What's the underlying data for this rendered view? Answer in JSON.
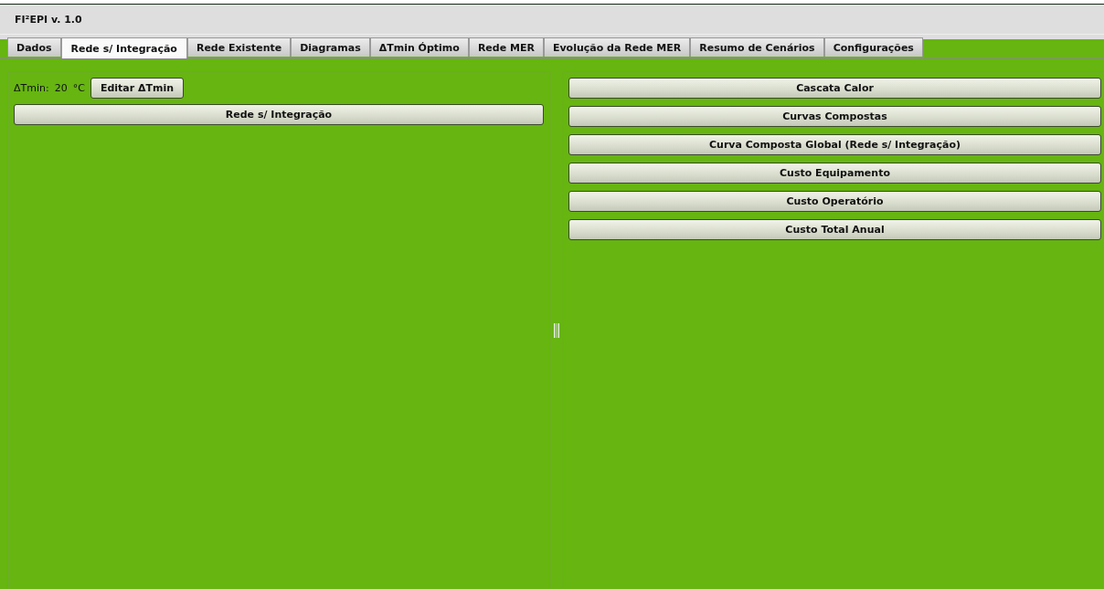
{
  "window": {
    "title": "FI²EPI v. 1.0"
  },
  "tabs": [
    {
      "label": "Dados",
      "selected": false
    },
    {
      "label": "Rede s/ Integração",
      "selected": true
    },
    {
      "label": "Rede Existente",
      "selected": false
    },
    {
      "label": "Diagramas",
      "selected": false
    },
    {
      "label": "ΔTmin Óptimo",
      "selected": false
    },
    {
      "label": "Rede MER",
      "selected": false
    },
    {
      "label": "Evolução da Rede MER",
      "selected": false
    },
    {
      "label": "Resumo de Cenários",
      "selected": false
    },
    {
      "label": "Configurações",
      "selected": false
    }
  ],
  "left_panel": {
    "dtmin_label": "ΔTmin:",
    "dtmin_value": "20",
    "dtmin_unit": "°C",
    "edit_button": "Editar ΔTmin",
    "main_button": "Rede s/ Integração"
  },
  "right_panel": {
    "buttons": [
      "Cascata Calor",
      "Curvas Compostas",
      "Curva Composta Global (Rede s/ Integração)",
      "Custo Equipamento",
      "Custo Operatório",
      "Custo Total Anual"
    ]
  }
}
